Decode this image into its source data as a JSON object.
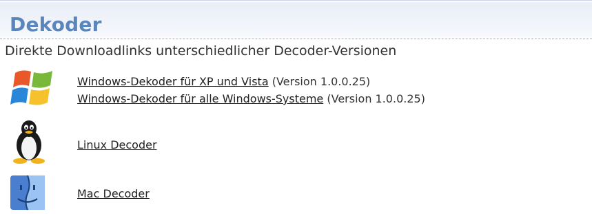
{
  "section": {
    "title": "Dekoder",
    "subtitle": "Direkte Downloadlinks unterschiedlicher Decoder-Versionen"
  },
  "windows": {
    "icon": "windows-logo-icon",
    "links": [
      {
        "label": "Windows-Dekoder für XP und Vista",
        "version": "(Version 1.0.0.25)"
      },
      {
        "label": "Windows-Dekoder für alle Windows-Systeme",
        "version": "(Version 1.0.0.25)"
      }
    ]
  },
  "linux": {
    "icon": "tux-penguin-icon",
    "label": "Linux Decoder"
  },
  "mac": {
    "icon": "mac-finder-icon",
    "label": "Mac Decoder"
  },
  "colors": {
    "title": "#5a86bb",
    "text": "#333333",
    "link": "#222222"
  }
}
